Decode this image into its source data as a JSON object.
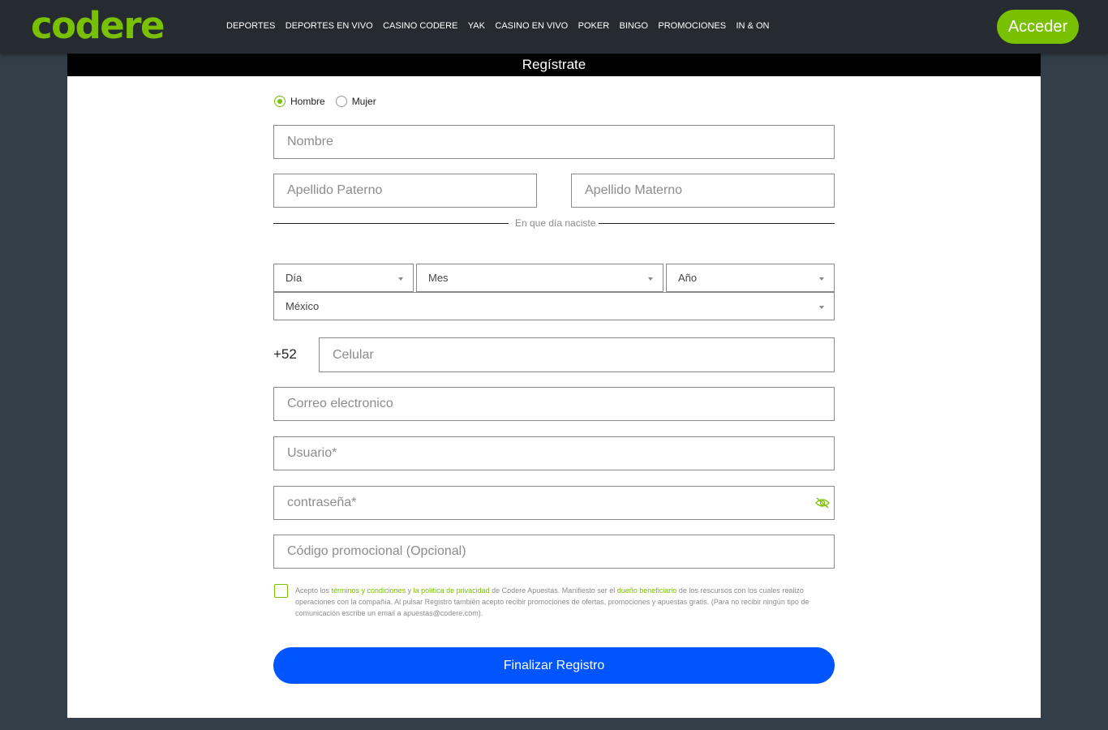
{
  "brand": {
    "logo_text": "codere",
    "accent": "#79c000",
    "submit_color": "#0055ff"
  },
  "nav": {
    "items": [
      "DEPORTES",
      "DEPORTES EN VIVO",
      "CASINO CODERE",
      "YAK",
      "CASINO EN VIVO",
      "POKER",
      "BINGO",
      "PROMOCIONES",
      "IN & ON"
    ],
    "login_label": "Acceder"
  },
  "form": {
    "title": "Regístrate",
    "gender": {
      "male": "Hombre",
      "female": "Mujer",
      "selected": "Hombre"
    },
    "nombre_placeholder": "Nombre",
    "apellido_paterno_placeholder": "Apellido Paterno",
    "apellido_materno_placeholder": "Apellido Materno",
    "birth_divider": "En que día naciste",
    "dia": "Día",
    "mes": "Mes",
    "anio": "Año",
    "pais": "México",
    "phone_prefix": "+52",
    "celular_placeholder": "Celular",
    "correo_placeholder": "Correo electronico",
    "usuario_placeholder": "Usuario*",
    "password_placeholder": "contraseña*",
    "promo_placeholder": "Código promocional (Opcional)",
    "legal": {
      "t1": "Acepto los ",
      "link_terms": "términos y condiciones",
      "t2": " y ",
      "link_privacy": "la política de privacidad",
      "t3": " de Codere Apuestas. Manifiesto ser el ",
      "link_owner": "dueño beneficiario",
      "t4": " de los rescursos con los cuales realizo operaciones con la compañía. Al pulsar Registro también acepto recibir promociones de ofertas, promociones y apuestas gratis. (Para no recibir ningún tipo de comunicación escribe un email a apuestas@codere.com)."
    },
    "submit_label": "Finalizar Registro"
  }
}
